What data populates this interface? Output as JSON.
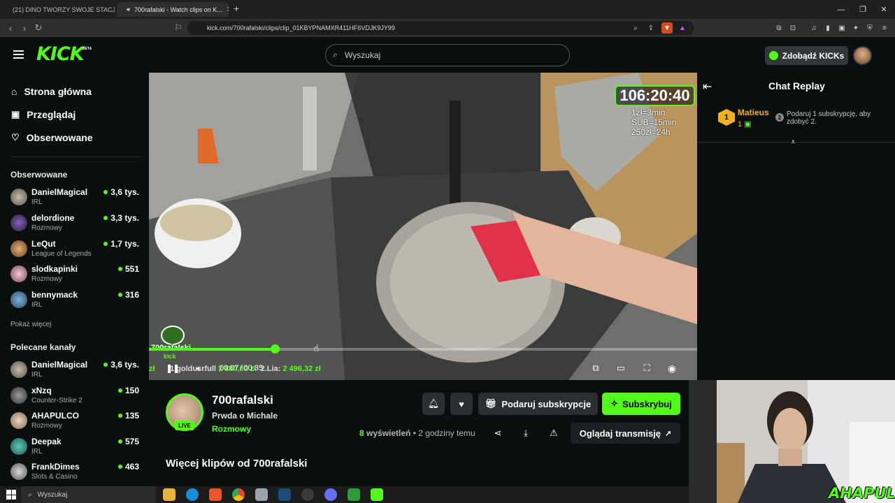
{
  "browser": {
    "tabs": [
      {
        "title": "(21) DINO TWORZY SWOJE STACJE..."
      },
      {
        "title": "700rafalski - Watch clips on K..."
      }
    ],
    "new_tab_glyph": "+",
    "url": "kick.com/700rafalski/clips/clip_01KBYPNAMXR411HF6VDJK9JY99"
  },
  "header": {
    "logo": "KICK",
    "beta": "BETA",
    "search_placeholder": "Wyszukaj",
    "kicks_button": "Zdobądź KICKs"
  },
  "sidebar": {
    "nav": [
      {
        "label": "Strona główna",
        "icon": "home-icon"
      },
      {
        "label": "Przeglądaj",
        "icon": "browse-icon"
      },
      {
        "label": "Obserwowane",
        "icon": "heart-icon"
      }
    ],
    "followed_title": "Obserwowane",
    "followed": [
      {
        "name": "DanielMagical",
        "category": "IRL",
        "viewers": "3,6 tys."
      },
      {
        "name": "delordione",
        "category": "Rozmowy",
        "viewers": "3,3 tys."
      },
      {
        "name": "LeQut",
        "category": "League of Legends",
        "viewers": "1,7 tys."
      },
      {
        "name": "slodkapinki",
        "category": "Rozmowy",
        "viewers": "551"
      },
      {
        "name": "bennymack",
        "category": "IRL",
        "viewers": "316"
      }
    ],
    "show_more": "Pokaż więcej",
    "recommended_title": "Polecane kanały",
    "recommended": [
      {
        "name": "DanielMagical",
        "category": "IRL",
        "viewers": "3,6 tys."
      },
      {
        "name": "xNzq",
        "category": "Counter-Strike 2",
        "viewers": "150"
      },
      {
        "name": "AHAPULCO",
        "category": "Rozmowy",
        "viewers": "135"
      },
      {
        "name": "Deepak",
        "category": "IRL",
        "viewers": "575"
      },
      {
        "name": "FrankDimes",
        "category": "Slots & Casino",
        "viewers": "463"
      }
    ]
  },
  "video": {
    "overlay_timer": "106:20:40",
    "overlay_rates": [
      "1zł=3min",
      "SUB=15min",
      "250zł=24h"
    ],
    "channel_badge": "700rafalski",
    "channel_badge_sub": "kick",
    "progress_fraction": 0.23,
    "time_current": "00:07",
    "time_total": "00:35",
    "ticker_prefix": "zł",
    "ticker_first": "1.goldusrfull",
    "ticker_first_amount": "2 800,00 zł",
    "ticker_second": "2.Lia:",
    "ticker_second_amount": "2 496,32 zł"
  },
  "chat": {
    "title": "Chat Replay",
    "message": {
      "badge": "1",
      "user": "Matieus",
      "count": "1",
      "gift_badge": "2",
      "text": "Podaruj 1 subskrypcję, aby zdobyć 2."
    }
  },
  "clip": {
    "live_label": "LIVE",
    "channel": "700rafalski",
    "title": "Prwda o Michale",
    "category": "Rozmowy",
    "gift_button": "Podaruj subskrypcje",
    "subscribe_button": "Subskrybuj",
    "views_count": "8",
    "views_label": "wyświetleń",
    "time_ago": "2 godziny temu",
    "watch_button": "Oglądaj transmisję",
    "more_clips": "Więcej klipów od 700rafalski"
  },
  "webcam": {
    "watermark": "AHAPULCO"
  },
  "taskbar": {
    "search_placeholder": "Wyszukaj"
  },
  "colors": {
    "accent": "#53fc18",
    "background": "#0b0e0f",
    "button": "#2b2f31"
  }
}
